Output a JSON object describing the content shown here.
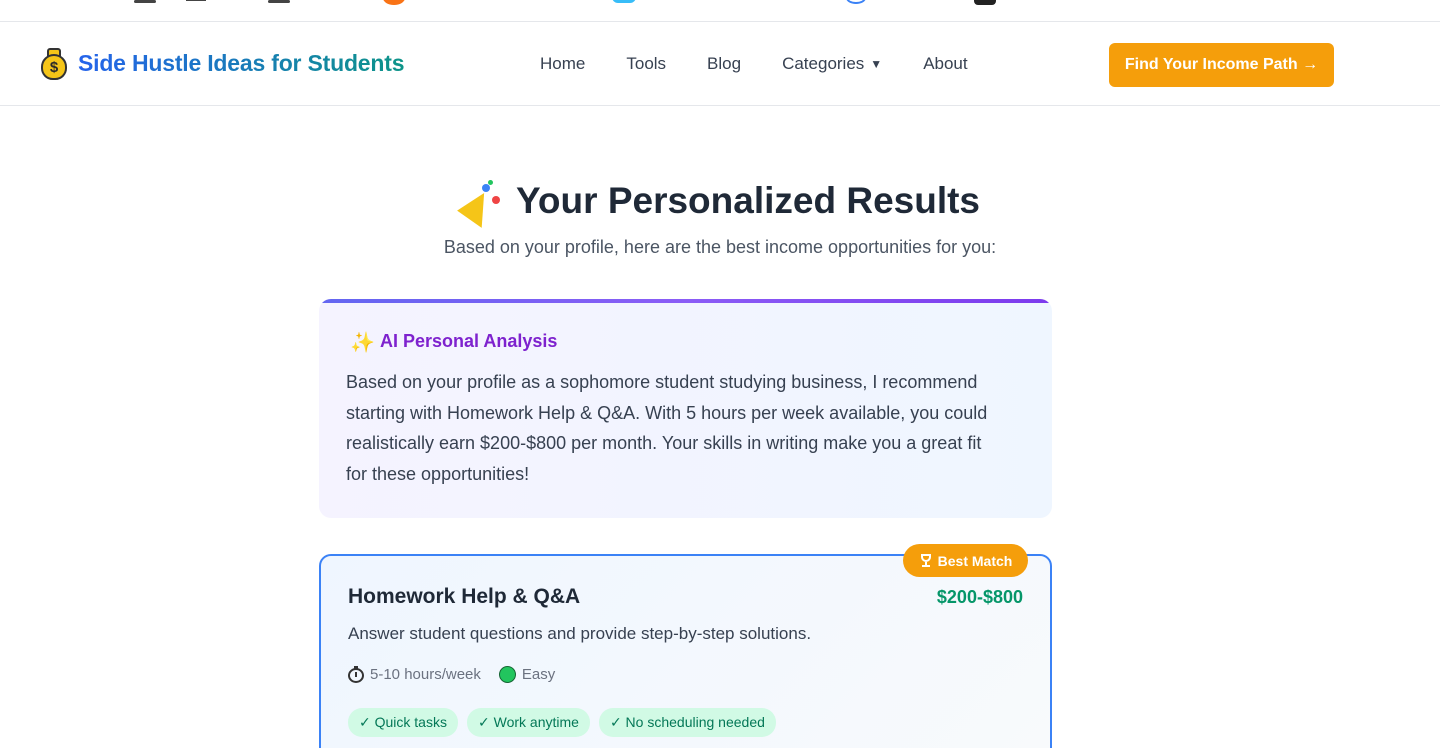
{
  "brand": {
    "title": "Side Hustle Ideas for Students"
  },
  "nav": {
    "items": [
      {
        "label": "Home"
      },
      {
        "label": "Tools"
      },
      {
        "label": "Blog"
      },
      {
        "label": "Categories"
      },
      {
        "label": "About"
      }
    ],
    "cta_label": "Find Your Income Path →"
  },
  "results": {
    "title": "Your Personalized Results",
    "subtitle": "Based on your profile, here are the best income opportunities for you:"
  },
  "ai_analysis": {
    "title": "AI Personal Analysis",
    "body": "Based on your profile as a sophomore student studying business, I recommend starting with Homework Help & Q&A. With 5 hours per week available, you could realistically earn $200-$800 per month. Your skills in writing make you a great fit for these opportunities!"
  },
  "hustle": {
    "badge": "Best Match",
    "title": "Homework Help & Q&A",
    "earnings": "$200-$800",
    "description": "Answer student questions and provide step-by-step solutions.",
    "time": "5-10 hours/week",
    "difficulty": "Easy",
    "tags": [
      "✓ Quick tasks",
      "✓ Work anytime",
      "✓ No scheduling needed"
    ]
  },
  "colors": {
    "accent_orange": "#f59e0b",
    "brand_blue": "#2563eb",
    "brand_teal": "#0d9488",
    "ai_purple": "#7e22ce",
    "earn_green": "#059669",
    "card_border": "#3b82f6"
  }
}
